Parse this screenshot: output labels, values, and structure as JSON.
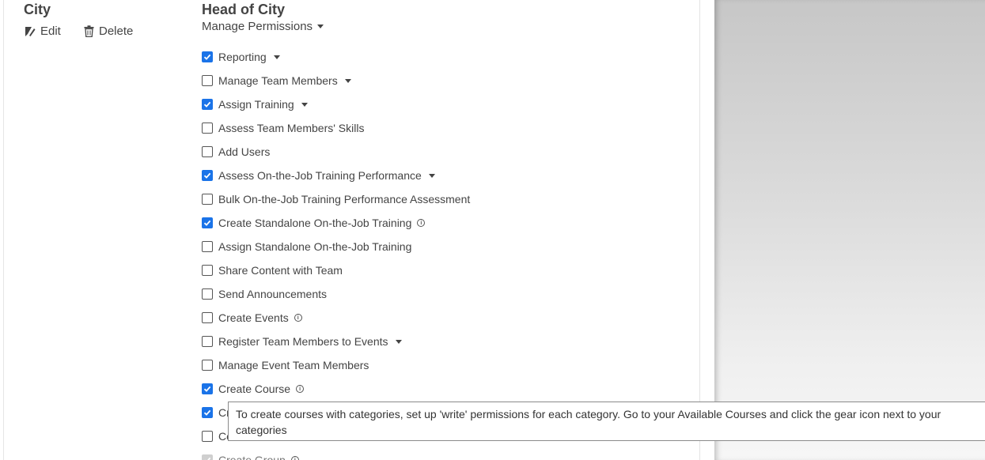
{
  "left": {
    "title": "City",
    "edit_label": "Edit",
    "delete_label": "Delete"
  },
  "role": {
    "title": "Head of City",
    "manage_permissions_label": "Manage Permissions"
  },
  "permissions": [
    {
      "label": "Reporting",
      "checked": true,
      "dropdown": true
    },
    {
      "label": "Manage Team Members",
      "checked": false,
      "dropdown": true
    },
    {
      "label": "Assign Training",
      "checked": true,
      "dropdown": true
    },
    {
      "label": "Assess Team Members' Skills",
      "checked": false
    },
    {
      "label": "Add Users",
      "checked": false
    },
    {
      "label": "Assess On-the-Job Training Performance",
      "checked": true,
      "dropdown": true
    },
    {
      "label": "Bulk On-the-Job Training Performance Assessment",
      "checked": false
    },
    {
      "label": "Create Standalone On-the-Job Training",
      "checked": true,
      "info": true
    },
    {
      "label": "Assign Standalone On-the-Job Training",
      "checked": false
    },
    {
      "label": "Share Content with Team",
      "checked": false
    },
    {
      "label": "Send Announcements",
      "checked": false
    },
    {
      "label": "Create Events",
      "checked": false,
      "info": true
    },
    {
      "label": "Register Team Members to Events",
      "checked": false,
      "dropdown": true
    },
    {
      "label": "Manage Event Team Members",
      "checked": false
    },
    {
      "label": "Create Course",
      "checked": true,
      "info": true
    },
    {
      "label": "Cr",
      "checked": true
    },
    {
      "label": "Co",
      "checked": false
    },
    {
      "label": "Create Group",
      "checked": true,
      "disabled": true,
      "info": true
    }
  ],
  "tooltip": {
    "text": "To create courses with categories, set up 'write' permissions for each category. Go to your Available Courses and click the gear icon next to your categories"
  },
  "colors": {
    "checkbox_checked": "#1a73e8",
    "text": "#444444"
  }
}
